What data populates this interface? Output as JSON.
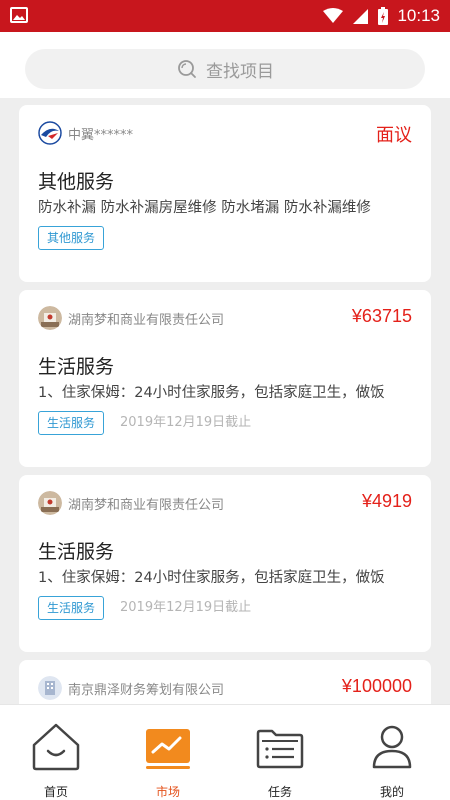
{
  "status_bar": {
    "time": "10:13"
  },
  "search": {
    "placeholder": "查找项目"
  },
  "cards": [
    {
      "company": "中翼******",
      "price": "面议",
      "title": "其他服务",
      "desc": "防水补漏 防水补漏房屋维修 防水堵漏 防水补漏维修",
      "tag": "其他服务",
      "deadline": ""
    },
    {
      "company": "湖南梦和商业有限责任公司",
      "price": "¥63715",
      "title": "生活服务",
      "desc": "1、住家保姆：24小时住家服务，包括家庭卫生，做饭",
      "tag": "生活服务",
      "deadline": "2019年12月19日截止"
    },
    {
      "company": "湖南梦和商业有限责任公司",
      "price": "¥4919",
      "title": "生活服务",
      "desc": "1、住家保姆：24小时住家服务，包括家庭卫生，做饭",
      "tag": "生活服务",
      "deadline": "2019年12月19日截止"
    },
    {
      "company": "南京鼎泽财务筹划有限公司",
      "price": "¥100000"
    }
  ],
  "tabs": [
    {
      "label": "首页",
      "icon": "home-icon"
    },
    {
      "label": "市场",
      "icon": "market-chart-icon",
      "active": true
    },
    {
      "label": "任务",
      "icon": "task-folder-icon"
    },
    {
      "label": "我的",
      "icon": "profile-icon"
    }
  ],
  "colors": {
    "status_bar": "#c8161d",
    "price": "#e4211a",
    "tag": "#2f98d2",
    "active_tab": "#e4511a"
  }
}
